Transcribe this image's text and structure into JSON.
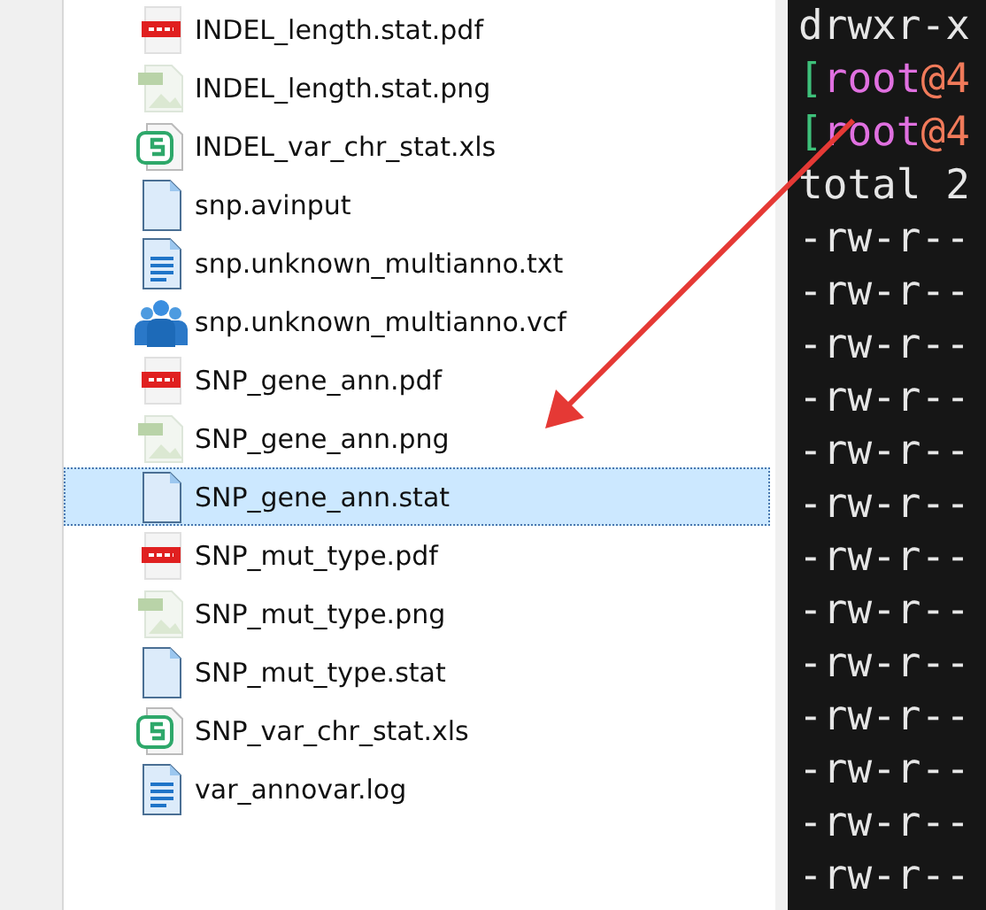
{
  "files": [
    {
      "name": "INDEL_length.stat.pdf",
      "kind": "pdf",
      "selected": false
    },
    {
      "name": "INDEL_length.stat.png",
      "kind": "png",
      "selected": false
    },
    {
      "name": "INDEL_var_chr_stat.xls",
      "kind": "xls",
      "selected": false
    },
    {
      "name": "snp.avinput",
      "kind": "plain",
      "selected": false
    },
    {
      "name": "snp.unknown_multianno.txt",
      "kind": "text",
      "selected": false
    },
    {
      "name": "snp.unknown_multianno.vcf",
      "kind": "contacts",
      "selected": false
    },
    {
      "name": "SNP_gene_ann.pdf",
      "kind": "pdf",
      "selected": false
    },
    {
      "name": "SNP_gene_ann.png",
      "kind": "png",
      "selected": false
    },
    {
      "name": "SNP_gene_ann.stat",
      "kind": "plain",
      "selected": true
    },
    {
      "name": "SNP_mut_type.pdf",
      "kind": "pdf",
      "selected": false
    },
    {
      "name": "SNP_mut_type.png",
      "kind": "png",
      "selected": false
    },
    {
      "name": "SNP_mut_type.stat",
      "kind": "plain",
      "selected": false
    },
    {
      "name": "SNP_var_chr_stat.xls",
      "kind": "xls",
      "selected": false
    },
    {
      "name": "var_annovar.log",
      "kind": "text",
      "selected": false
    }
  ],
  "terminal": {
    "lines": [
      [
        {
          "kind": "plain",
          "text": "drwxr-x"
        }
      ],
      [
        {
          "kind": "bracket",
          "text": "["
        },
        {
          "kind": "user",
          "text": "root"
        },
        {
          "kind": "host",
          "text": "@4"
        }
      ],
      [
        {
          "kind": "bracket",
          "text": "["
        },
        {
          "kind": "user",
          "text": "root"
        },
        {
          "kind": "host",
          "text": "@4"
        }
      ],
      [
        {
          "kind": "plain",
          "text": "total 2"
        }
      ],
      [
        {
          "kind": "plain",
          "text": "-rw-r--"
        }
      ],
      [
        {
          "kind": "plain",
          "text": "-rw-r--"
        }
      ],
      [
        {
          "kind": "plain",
          "text": "-rw-r--"
        }
      ],
      [
        {
          "kind": "plain",
          "text": "-rw-r--"
        }
      ],
      [
        {
          "kind": "plain",
          "text": "-rw-r--"
        }
      ],
      [
        {
          "kind": "plain",
          "text": "-rw-r--"
        }
      ],
      [
        {
          "kind": "plain",
          "text": "-rw-r--"
        }
      ],
      [
        {
          "kind": "plain",
          "text": "-rw-r--"
        }
      ],
      [
        {
          "kind": "plain",
          "text": "-rw-r--"
        }
      ],
      [
        {
          "kind": "plain",
          "text": "-rw-r--"
        }
      ],
      [
        {
          "kind": "plain",
          "text": "-rw-r--"
        }
      ],
      [
        {
          "kind": "plain",
          "text": "-rw-r--"
        }
      ],
      [
        {
          "kind": "plain",
          "text": "-rw-r--"
        }
      ]
    ]
  }
}
